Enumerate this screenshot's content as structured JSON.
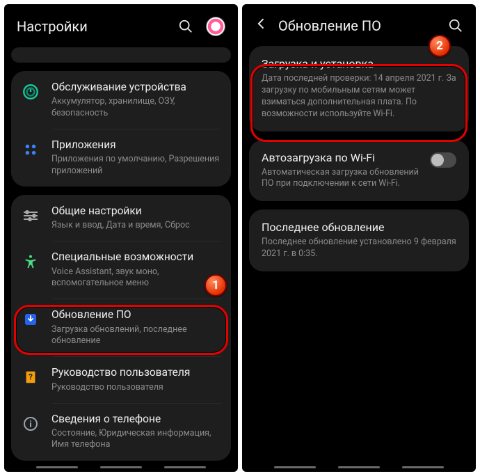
{
  "left": {
    "title": "Настройки",
    "stub_visible": true,
    "groups": [
      {
        "rows": [
          {
            "id": "device-care",
            "icon": "device-care-icon",
            "title": "Обслуживание устройства",
            "sub": "Аккумулятор, хранилище, ОЗУ, безопасность"
          },
          {
            "id": "apps",
            "icon": "apps-icon",
            "title": "Приложения",
            "sub": "Приложения по умолчанию, Разрешения приложений"
          }
        ]
      },
      {
        "rows": [
          {
            "id": "general",
            "icon": "sliders-icon",
            "title": "Общие настройки",
            "sub": "Язык и ввод, Дата и время, Сброс"
          },
          {
            "id": "accessibility",
            "icon": "accessibility-icon",
            "title": "Специальные возможности",
            "sub": "Voice Assistant, звук моно, вспомогательное меню"
          },
          {
            "id": "software-update",
            "icon": "software-update-icon",
            "title": "Обновление ПО",
            "sub": "Загрузка обновлений, последнее обновление"
          },
          {
            "id": "user-manual",
            "icon": "user-manual-icon",
            "title": "Руководство пользователя",
            "sub": "Руководство пользователя"
          },
          {
            "id": "about-phone",
            "icon": "info-icon",
            "title": "Сведения о телефоне",
            "sub": "Состояние, Юридическая информация, Имя телефона"
          }
        ]
      }
    ],
    "highlight_badge": "1"
  },
  "right": {
    "title": "Обновление ПО",
    "items": [
      {
        "id": "download-install",
        "title": "Загрузка и установка",
        "sub": "Дата последней проверки: 14 апреля 2021 г. За загрузку по мобильным сетям может взиматься дополнительная плата. По возможности используйте Wi-Fi."
      },
      {
        "id": "auto-wifi",
        "title": "Автозагрузка по Wi-Fi",
        "sub": "Автоматическая загрузка обновлений ПО при подключении к сети Wi-Fi.",
        "toggle": false
      },
      {
        "id": "last-update",
        "title": "Последнее обновление",
        "sub": "Последнее обновление установлено 9 февраля 2021 г. в 0:35."
      }
    ],
    "highlight_badge": "2"
  }
}
